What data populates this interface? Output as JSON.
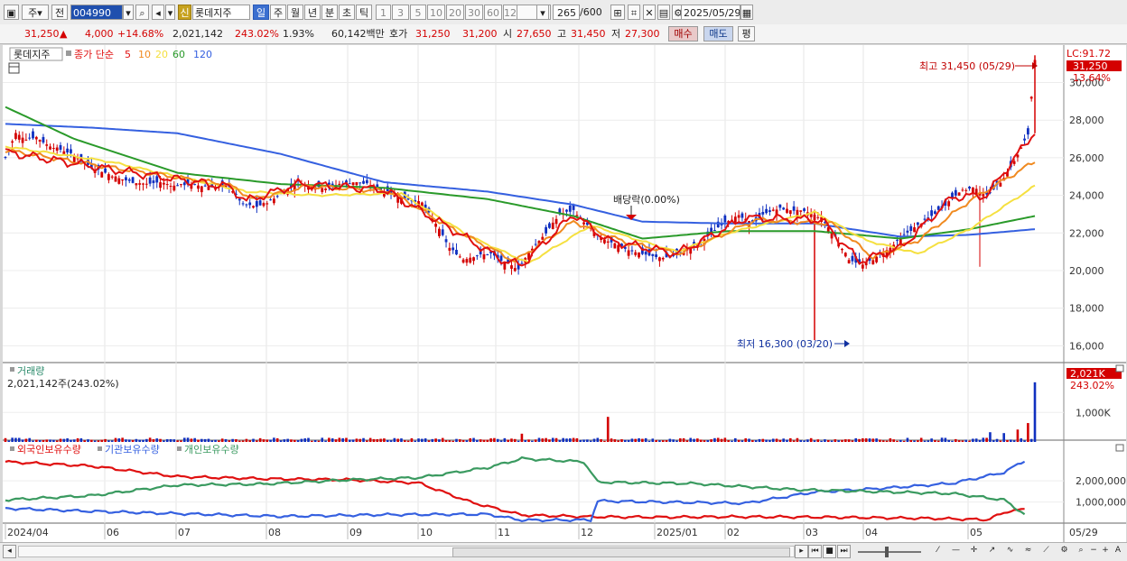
{
  "toolbar": {
    "period_type": "주",
    "prev_label": "전",
    "stock_code": "004990",
    "new_label": "신",
    "stock_name": "롯데지주",
    "period_tabs": [
      {
        "label": "일",
        "active": true
      },
      {
        "label": "주",
        "active": false
      },
      {
        "label": "월",
        "active": false
      },
      {
        "label": "년",
        "active": false
      },
      {
        "label": "분",
        "active": false
      },
      {
        "label": "초",
        "active": false
      },
      {
        "label": "틱",
        "active": false
      }
    ],
    "interval_buttons": [
      "1",
      "3",
      "5",
      "10",
      "20",
      "30",
      "60",
      "120"
    ],
    "view_count": "265",
    "view_total": "/600",
    "date": "2025/05/29"
  },
  "quote": {
    "price": "31,250",
    "change_arrow": "▲",
    "change": "4,000",
    "change_pct": "+14.68%",
    "volume": "2,021,142",
    "volume_ratio": "243.02%",
    "turnover": "1.93%",
    "amount": "60,142백만",
    "bid_label": "호가",
    "ask": "31,250",
    "bid": "31,200",
    "open_label": "시",
    "open": "27,650",
    "high_label": "고",
    "high": "31,450",
    "low_label": "저",
    "low": "27,300",
    "buy_label": "매수",
    "sell_label": "매도",
    "eval_label": "평"
  },
  "colors": {
    "up": "#d40000",
    "down": "#1030c0",
    "ma5": "#e01010",
    "ma10": "#f08a20",
    "ma20": "#f5e040",
    "ma60": "#2a9a2a",
    "ma120": "#3560e0",
    "foreign": "#e01010",
    "institution": "#3560e0",
    "individual": "#3a9a60"
  },
  "price_panel": {
    "stock_label": "롯데지주",
    "legend_prefix": "종가 단순",
    "ma_labels": [
      "5",
      "10",
      "20",
      "60",
      "120"
    ],
    "lc_label": "LC:91.72",
    "last_price_tag": "31,250",
    "last_pct_tag": "13.64%",
    "y_ticks": [
      "30,000",
      "28,000",
      "26,000",
      "24,000",
      "22,000",
      "20,000",
      "18,000",
      "16,000"
    ],
    "high_annotation": "최고 31,450 (05/29)",
    "low_annotation": "최저 16,300 (03/20)",
    "dividend_annotation": "배당락(0.00%)"
  },
  "volume_panel": {
    "title": "거래량",
    "value_text": "2,021,142주(243.02%)",
    "tag_value": "2,021K",
    "tag_pct": "243.02%",
    "y_tick": "1,000K"
  },
  "holding_panel": {
    "legend": [
      "외국인보유수량",
      "기관보유수량",
      "개인보유수량"
    ],
    "y_ticks": [
      "2,000,000",
      "1,000,000"
    ]
  },
  "x_axis": {
    "labels": [
      "2024/04",
      "06",
      "07",
      "08",
      "09",
      "10",
      "11",
      "12",
      "2025/01",
      "02",
      "03",
      "04",
      "05",
      "05/29"
    ]
  },
  "chart_data": [
    {
      "type": "candlestick",
      "title": "롯데지주",
      "ylim": [
        15200,
        31800
      ],
      "note": "Daily price with 5/10/20/60/120 simple moving averages",
      "close_path": [
        [
          0,
          26000
        ],
        [
          3,
          27300
        ],
        [
          6,
          27000
        ],
        [
          9,
          27100
        ],
        [
          12,
          26700
        ],
        [
          15,
          26500
        ],
        [
          18,
          26300
        ],
        [
          21,
          26000
        ],
        [
          25,
          25500
        ],
        [
          29,
          25200
        ],
        [
          33,
          24900
        ],
        [
          37,
          24700
        ],
        [
          41,
          24600
        ],
        [
          45,
          24700
        ],
        [
          49,
          24500
        ],
        [
          53,
          24600
        ],
        [
          57,
          24500
        ],
        [
          61,
          24450
        ],
        [
          65,
          24500
        ],
        [
          69,
          23500
        ],
        [
          73,
          23400
        ],
        [
          77,
          23700
        ],
        [
          81,
          24200
        ],
        [
          85,
          24700
        ],
        [
          89,
          24500
        ],
        [
          93,
          24400
        ],
        [
          97,
          24600
        ],
        [
          101,
          24700
        ],
        [
          105,
          24600
        ],
        [
          109,
          24300
        ],
        [
          113,
          24000
        ],
        [
          117,
          23800
        ],
        [
          121,
          23600
        ],
        [
          125,
          22500
        ],
        [
          129,
          21200
        ],
        [
          133,
          20600
        ],
        [
          137,
          20800
        ],
        [
          141,
          20900
        ],
        [
          145,
          20400
        ],
        [
          149,
          20100
        ],
        [
          153,
          21200
        ],
        [
          157,
          22000
        ],
        [
          161,
          23000
        ],
        [
          165,
          23200
        ],
        [
          169,
          22400
        ],
        [
          173,
          21700
        ],
        [
          177,
          21400
        ],
        [
          181,
          21100
        ],
        [
          185,
          20900
        ],
        [
          189,
          20700
        ],
        [
          193,
          20700
        ],
        [
          197,
          21000
        ],
        [
          201,
          21400
        ],
        [
          205,
          22000
        ],
        [
          209,
          22600
        ],
        [
          213,
          22900
        ],
        [
          217,
          22500
        ],
        [
          221,
          23100
        ],
        [
          225,
          23300
        ],
        [
          229,
          23200
        ],
        [
          233,
          23100
        ],
        [
          237,
          22800
        ],
        [
          241,
          21800
        ],
        [
          245,
          20600
        ],
        [
          249,
          20300
        ],
        [
          253,
          20700
        ],
        [
          257,
          21200
        ],
        [
          261,
          21900
        ],
        [
          265,
          22400
        ],
        [
          269,
          22900
        ],
        [
          273,
          23500
        ],
        [
          277,
          24200
        ],
        [
          281,
          24400
        ],
        [
          285,
          24000
        ],
        [
          289,
          24700
        ],
        [
          293,
          25800
        ],
        [
          297,
          27250
        ],
        [
          299,
          31250
        ]
      ],
      "ma5": [
        [
          0,
          26300
        ],
        [
          30,
          25400
        ],
        [
          65,
          24450
        ],
        [
          70,
          23700
        ],
        [
          85,
          24600
        ],
        [
          110,
          24300
        ],
        [
          125,
          22700
        ],
        [
          145,
          20500
        ],
        [
          150,
          20300
        ],
        [
          165,
          23000
        ],
        [
          175,
          21600
        ],
        [
          195,
          20900
        ],
        [
          215,
          22800
        ],
        [
          237,
          22700
        ],
        [
          248,
          20500
        ],
        [
          260,
          21200
        ],
        [
          275,
          23900
        ],
        [
          285,
          24000
        ],
        [
          299,
          27400
        ]
      ],
      "ma10": [
        [
          0,
          26400
        ],
        [
          30,
          25500
        ],
        [
          65,
          24550
        ],
        [
          72,
          23800
        ],
        [
          88,
          24500
        ],
        [
          112,
          24200
        ],
        [
          128,
          22400
        ],
        [
          148,
          20500
        ],
        [
          165,
          22600
        ],
        [
          180,
          21500
        ],
        [
          196,
          20900
        ],
        [
          218,
          22700
        ],
        [
          240,
          22500
        ],
        [
          252,
          20700
        ],
        [
          265,
          21600
        ],
        [
          280,
          23700
        ],
        [
          299,
          25800
        ]
      ],
      "ma20": [
        [
          0,
          26600
        ],
        [
          30,
          25800
        ],
        [
          70,
          24200
        ],
        [
          90,
          24000
        ],
        [
          115,
          24100
        ],
        [
          135,
          21800
        ],
        [
          152,
          20400
        ],
        [
          170,
          22400
        ],
        [
          195,
          21000
        ],
        [
          210,
          22000
        ],
        [
          235,
          23100
        ],
        [
          250,
          21600
        ],
        [
          265,
          20900
        ],
        [
          280,
          22200
        ],
        [
          299,
          24500
        ]
      ],
      "ma60": [
        [
          0,
          28700
        ],
        [
          20,
          27000
        ],
        [
          50,
          25200
        ],
        [
          80,
          24600
        ],
        [
          110,
          24400
        ],
        [
          140,
          23800
        ],
        [
          165,
          22900
        ],
        [
          185,
          21700
        ],
        [
          210,
          22100
        ],
        [
          235,
          22100
        ],
        [
          260,
          21700
        ],
        [
          280,
          22200
        ],
        [
          299,
          22900
        ]
      ],
      "ma120": [
        [
          0,
          27800
        ],
        [
          25,
          27600
        ],
        [
          50,
          27300
        ],
        [
          80,
          26200
        ],
        [
          110,
          24700
        ],
        [
          140,
          24200
        ],
        [
          165,
          23500
        ],
        [
          185,
          22600
        ],
        [
          210,
          22500
        ],
        [
          235,
          22500
        ],
        [
          260,
          21800
        ],
        [
          280,
          21900
        ],
        [
          299,
          22200
        ]
      ],
      "max_point": {
        "index": 299,
        "value": 31450,
        "date": "05/29"
      },
      "min_point": {
        "index": 235,
        "value": 16300,
        "date": "03/20"
      },
      "dividend_point": {
        "index": 172,
        "label": "배당락(0.00%)"
      }
    },
    {
      "type": "bar",
      "title": "거래량",
      "unit": "K shares",
      "ylim": [
        0,
        2200
      ],
      "spikes": [
        [
          150,
          280
        ],
        [
          175,
          850
        ],
        [
          299,
          2021
        ],
        [
          297,
          640
        ],
        [
          294,
          420
        ],
        [
          286,
          330
        ],
        [
          290,
          300
        ]
      ],
      "base_level": 90
    },
    {
      "type": "line",
      "title": "보유수량",
      "ylim": [
        0,
        3200000
      ],
      "series": [
        {
          "name": "외국인보유수량",
          "values": [
            [
              0,
              2900000
            ],
            [
              25,
              2700000
            ],
            [
              50,
              2200000
            ],
            [
              75,
              2100000
            ],
            [
              100,
              2050000
            ],
            [
              120,
              1900000
            ],
            [
              135,
              1000000
            ],
            [
              150,
              380000
            ],
            [
              170,
              300000
            ],
            [
              190,
              280000
            ],
            [
              210,
              300000
            ],
            [
              230,
              290000
            ],
            [
              250,
              260000
            ],
            [
              270,
              220000
            ],
            [
              285,
              160000
            ],
            [
              292,
              600000
            ],
            [
              296,
              630000
            ]
          ]
        },
        {
          "name": "기관보유수량",
          "values": [
            [
              0,
              700000
            ],
            [
              25,
              560000
            ],
            [
              50,
              450000
            ],
            [
              80,
              320000
            ],
            [
              110,
              400000
            ],
            [
              140,
              420000
            ],
            [
              150,
              140000
            ],
            [
              170,
              150000
            ],
            [
              172,
              1050000
            ],
            [
              190,
              1000000
            ],
            [
              215,
              940000
            ],
            [
              235,
              1470000
            ],
            [
              255,
              1650000
            ],
            [
              275,
              1880000
            ],
            [
              290,
              2400000
            ],
            [
              296,
              2950000
            ]
          ]
        },
        {
          "name": "개인보유수량",
          "values": [
            [
              0,
              1100000
            ],
            [
              25,
              1300000
            ],
            [
              50,
              1800000
            ],
            [
              75,
              1850000
            ],
            [
              100,
              2050000
            ],
            [
              120,
              2150000
            ],
            [
              140,
              2620000
            ],
            [
              150,
              3050000
            ],
            [
              168,
              2900000
            ],
            [
              172,
              1940000
            ],
            [
              200,
              1870000
            ],
            [
              230,
              1580000
            ],
            [
              255,
              1480000
            ],
            [
              275,
              1400000
            ],
            [
              290,
              1100000
            ],
            [
              296,
              420000
            ]
          ]
        }
      ]
    }
  ]
}
